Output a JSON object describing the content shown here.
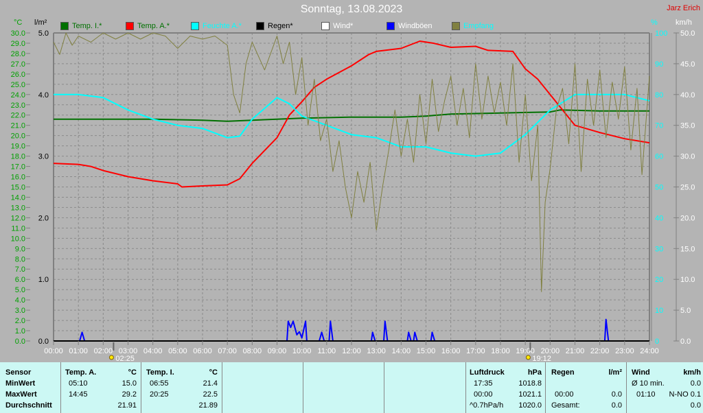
{
  "title": "Sonntag, 13.08.2023",
  "author": "Jarz Erich",
  "units": {
    "celsius": "°C",
    "rain": "l/m²",
    "percent": "%",
    "speed": "km/h"
  },
  "legend": [
    {
      "label": "Temp. I.*",
      "color": "#007000",
      "text_color": "#007000"
    },
    {
      "label": "Temp. A.*",
      "color": "#ff0000",
      "text_color": "#007000"
    },
    {
      "label": "Feuchte A.*",
      "color": "#00ffff",
      "text_color": "#00ffff"
    },
    {
      "label": "Regen*",
      "color": "#000000",
      "text_color": "#000000"
    },
    {
      "label": "Wind*",
      "color": "#ffffff",
      "text_color": "#ffffff"
    },
    {
      "label": "Windböen",
      "color": "#0000ff",
      "text_color": "#ffffff"
    },
    {
      "label": "Empfang",
      "color": "#808040",
      "text_color": "#00ffff"
    }
  ],
  "markers": [
    {
      "time": "02:25",
      "label": "02:25"
    },
    {
      "time": "19:12",
      "label": "19:12"
    }
  ],
  "chart_data": {
    "type": "line",
    "x_ticks": [
      "00:00",
      "01:00",
      "02:00",
      "03:00",
      "04:00",
      "05:00",
      "06:00",
      "07:00",
      "08:00",
      "09:00",
      "10:00",
      "11:00",
      "12:00",
      "13:00",
      "14:00",
      "15:00",
      "16:00",
      "17:00",
      "18:00",
      "19:00",
      "20:00",
      "21:00",
      "22:00",
      "23:00",
      "24:00"
    ],
    "xlim_hours": [
      0,
      24
    ],
    "y_celsius": {
      "lim": [
        0,
        30
      ],
      "ticks": [
        "0.0",
        "1.0",
        "2.0",
        "3.0",
        "4.0",
        "5.0",
        "6.0",
        "7.0",
        "8.0",
        "9.0",
        "10.0",
        "11.0",
        "12.0",
        "13.0",
        "14.0",
        "15.0",
        "16.0",
        "17.0",
        "18.0",
        "19.0",
        "20.0",
        "21.0",
        "22.0",
        "23.0",
        "24.0",
        "25.0",
        "26.0",
        "27.0",
        "28.0",
        "29.0",
        "30.0"
      ]
    },
    "y_rain": {
      "lim": [
        0,
        5
      ],
      "ticks": [
        "0.0",
        "1.0",
        "2.0",
        "3.0",
        "4.0",
        "5.0"
      ]
    },
    "y_percent": {
      "lim": [
        0,
        100
      ],
      "ticks": [
        "0",
        "10",
        "20",
        "30",
        "40",
        "50",
        "60",
        "70",
        "80",
        "90",
        "100"
      ]
    },
    "y_speed": {
      "lim": [
        0,
        50
      ],
      "ticks": [
        "0.0",
        "5.0",
        "10.0",
        "15.0",
        "20.0",
        "25.0",
        "30.0",
        "35.0",
        "40.0",
        "45.0",
        "50.0"
      ]
    },
    "grid": true,
    "series": [
      {
        "name": "Temp. I.*",
        "axis": "celsius",
        "color": "#007000",
        "points": [
          [
            0,
            21.6
          ],
          [
            2,
            21.6
          ],
          [
            4,
            21.6
          ],
          [
            6,
            21.5
          ],
          [
            7,
            21.4
          ],
          [
            8,
            21.5
          ],
          [
            9,
            21.6
          ],
          [
            10,
            21.7
          ],
          [
            12,
            21.8
          ],
          [
            14,
            21.8
          ],
          [
            15,
            21.9
          ],
          [
            16,
            22.1
          ],
          [
            18,
            22.2
          ],
          [
            20,
            22.3
          ],
          [
            20.4,
            22.5
          ],
          [
            22,
            22.4
          ],
          [
            24,
            22.4
          ]
        ]
      },
      {
        "name": "Temp. A.*",
        "axis": "celsius",
        "color": "#ff0000",
        "points": [
          [
            0,
            17.3
          ],
          [
            1,
            17.2
          ],
          [
            1.5,
            17.0
          ],
          [
            2,
            16.6
          ],
          [
            3,
            16.0
          ],
          [
            4,
            15.6
          ],
          [
            5,
            15.3
          ],
          [
            5.17,
            15.0
          ],
          [
            6,
            15.1
          ],
          [
            7,
            15.2
          ],
          [
            7.5,
            15.8
          ],
          [
            8,
            17.3
          ],
          [
            9,
            19.8
          ],
          [
            9.5,
            22.0
          ],
          [
            10,
            23.3
          ],
          [
            10.5,
            24.7
          ],
          [
            11,
            25.5
          ],
          [
            12,
            26.8
          ],
          [
            12.7,
            27.9
          ],
          [
            13,
            28.2
          ],
          [
            14,
            28.5
          ],
          [
            14.75,
            29.2
          ],
          [
            15.3,
            29.0
          ],
          [
            16,
            28.6
          ],
          [
            17,
            28.7
          ],
          [
            17.5,
            28.3
          ],
          [
            18.5,
            28.2
          ],
          [
            19,
            26.5
          ],
          [
            19.5,
            25.5
          ],
          [
            20,
            24.0
          ],
          [
            20.5,
            22.5
          ],
          [
            21,
            21.0
          ],
          [
            22,
            20.3
          ],
          [
            23,
            19.7
          ],
          [
            24,
            19.3
          ]
        ]
      },
      {
        "name": "Feuchte A.*",
        "axis": "percent",
        "color": "#00ffff",
        "points": [
          [
            0,
            80
          ],
          [
            1,
            80
          ],
          [
            2,
            79
          ],
          [
            3,
            75
          ],
          [
            4,
            72
          ],
          [
            5,
            70
          ],
          [
            6,
            69
          ],
          [
            7,
            66
          ],
          [
            7.5,
            66.5
          ],
          [
            8,
            72
          ],
          [
            9,
            79
          ],
          [
            9.5,
            77
          ],
          [
            10,
            73
          ],
          [
            11,
            70
          ],
          [
            12,
            67
          ],
          [
            13,
            66
          ],
          [
            14,
            63
          ],
          [
            15,
            63
          ],
          [
            16,
            61
          ],
          [
            17,
            60
          ],
          [
            18,
            61
          ],
          [
            19,
            67
          ],
          [
            20,
            75
          ],
          [
            21,
            80
          ],
          [
            22,
            80
          ],
          [
            23,
            80
          ],
          [
            24,
            78
          ]
        ]
      },
      {
        "name": "Windböen",
        "axis": "speed",
        "color": "#0000ff",
        "points": [
          [
            0,
            0
          ],
          [
            1.05,
            0
          ],
          [
            1.15,
            1.4
          ],
          [
            1.25,
            0
          ],
          [
            9.4,
            0
          ],
          [
            9.45,
            3.2
          ],
          [
            9.55,
            2.2
          ],
          [
            9.65,
            3.2
          ],
          [
            9.8,
            1.0
          ],
          [
            9.9,
            1.5
          ],
          [
            10.0,
            0.5
          ],
          [
            10.15,
            3.2
          ],
          [
            10.2,
            0
          ],
          [
            10.7,
            0
          ],
          [
            10.8,
            1.4
          ],
          [
            10.9,
            0
          ],
          [
            11.1,
            0
          ],
          [
            11.15,
            3.2
          ],
          [
            11.25,
            0
          ],
          [
            12.8,
            0
          ],
          [
            12.85,
            1.4
          ],
          [
            12.95,
            0
          ],
          [
            13.3,
            0
          ],
          [
            13.35,
            3.2
          ],
          [
            13.45,
            0
          ],
          [
            14.25,
            0
          ],
          [
            14.3,
            1.4
          ],
          [
            14.4,
            0
          ],
          [
            14.5,
            0
          ],
          [
            14.55,
            1.4
          ],
          [
            14.65,
            0
          ],
          [
            15.2,
            0
          ],
          [
            15.25,
            1.4
          ],
          [
            15.35,
            0
          ],
          [
            22.2,
            0
          ],
          [
            22.25,
            3.5
          ],
          [
            22.35,
            0
          ],
          [
            24,
            0
          ]
        ]
      },
      {
        "name": "Empfang",
        "axis": "percent",
        "color": "#808040",
        "points": [
          [
            0,
            97
          ],
          [
            0.25,
            93
          ],
          [
            0.5,
            100
          ],
          [
            0.75,
            96
          ],
          [
            1,
            99
          ],
          [
            1.5,
            97
          ],
          [
            2,
            100
          ],
          [
            2.5,
            98
          ],
          [
            3,
            100
          ],
          [
            3.5,
            98
          ],
          [
            4,
            100
          ],
          [
            4.5,
            99
          ],
          [
            5,
            95
          ],
          [
            5.5,
            99
          ],
          [
            6,
            98
          ],
          [
            6.5,
            99
          ],
          [
            7,
            96
          ],
          [
            7.25,
            80
          ],
          [
            7.5,
            74
          ],
          [
            7.75,
            90
          ],
          [
            8,
            97
          ],
          [
            8.5,
            88
          ],
          [
            9,
            99
          ],
          [
            9.25,
            90
          ],
          [
            9.5,
            97
          ],
          [
            9.75,
            80
          ],
          [
            10,
            92
          ],
          [
            10.25,
            70
          ],
          [
            10.5,
            85
          ],
          [
            10.75,
            65
          ],
          [
            11,
            72
          ],
          [
            11.25,
            55
          ],
          [
            11.5,
            65
          ],
          [
            11.75,
            50
          ],
          [
            12,
            40
          ],
          [
            12.25,
            55
          ],
          [
            12.5,
            45
          ],
          [
            12.75,
            58
          ],
          [
            13,
            36
          ],
          [
            13.25,
            50
          ],
          [
            13.5,
            62
          ],
          [
            13.75,
            75
          ],
          [
            14,
            60
          ],
          [
            14.25,
            72
          ],
          [
            14.5,
            58
          ],
          [
            14.75,
            80
          ],
          [
            15,
            64
          ],
          [
            15.25,
            85
          ],
          [
            15.5,
            68
          ],
          [
            15.75,
            78
          ],
          [
            16,
            86
          ],
          [
            16.25,
            70
          ],
          [
            16.5,
            82
          ],
          [
            16.75,
            66
          ],
          [
            17,
            90
          ],
          [
            17.25,
            72
          ],
          [
            17.5,
            86
          ],
          [
            17.75,
            74
          ],
          [
            18,
            84
          ],
          [
            18.25,
            70
          ],
          [
            18.5,
            90
          ],
          [
            18.75,
            58
          ],
          [
            19,
            80
          ],
          [
            19.25,
            52
          ],
          [
            19.5,
            70
          ],
          [
            19.65,
            16
          ],
          [
            19.8,
            45
          ],
          [
            20,
            56
          ],
          [
            20.25,
            75
          ],
          [
            20.5,
            82
          ],
          [
            20.75,
            64
          ],
          [
            21,
            90
          ],
          [
            21.25,
            55
          ],
          [
            21.5,
            85
          ],
          [
            21.75,
            70
          ],
          [
            22,
            88
          ],
          [
            22.25,
            66
          ],
          [
            22.5,
            84
          ],
          [
            22.75,
            72
          ],
          [
            23,
            89
          ],
          [
            23.25,
            62
          ],
          [
            23.5,
            82
          ],
          [
            23.7,
            54
          ],
          [
            24,
            86
          ]
        ]
      }
    ]
  },
  "table": {
    "row_labels": [
      "Sensor",
      "MinWert",
      "MaxWert",
      "Durchschnitt"
    ],
    "temp_a": {
      "header": "Temp. A.",
      "unit": "°C",
      "min_time": "05:10",
      "min": "15.0",
      "max_time": "14:45",
      "max": "29.2",
      "avg": "21.91"
    },
    "temp_i": {
      "header": "Temp. I.",
      "unit": "°C",
      "min_time": "06:55",
      "min": "21.4",
      "max_time": "20:25",
      "max": "22.5",
      "avg": "21.89"
    },
    "pressure": {
      "header": "Luftdruck",
      "unit": "hPa",
      "r1_left": "17:35",
      "r1_right": "1018.8",
      "r2_left": "00:00",
      "r2_right": "1021.1",
      "r3_left": "^0.7hPa/h",
      "r3_right": "1020.0"
    },
    "rain": {
      "header": "Regen",
      "unit": "l/m²",
      "r2_left": "00:00",
      "r2_right": "0.0",
      "r3_left": "Gesamt:",
      "r3_right": "0.0"
    },
    "wind": {
      "header": "Wind",
      "unit": "km/h",
      "r1_left": "Ø 10 min.",
      "r1_right": "0.0",
      "r2_left": "01:10",
      "r2_right": "N-NO 0.1",
      "r3_right": "0.0"
    }
  }
}
